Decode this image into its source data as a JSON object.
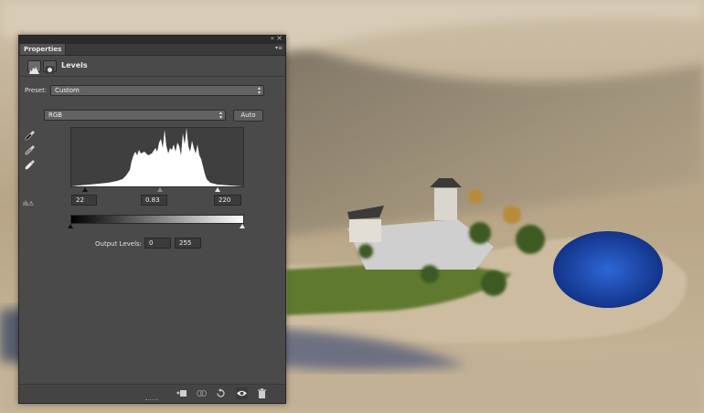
{
  "panel": {
    "tab_label": "Properties",
    "title": "Levels",
    "collapse_glyph": "«",
    "close_glyph": "×",
    "menu_glyph": "▾≡",
    "preset_label": "Preset:",
    "preset_value": "Custom",
    "channel_value": "RGB",
    "auto_label": "Auto",
    "input_black": "22",
    "input_gamma": "0.83",
    "input_white": "220",
    "output_label": "Output Levels:",
    "output_black": "0",
    "output_white": "255",
    "clip_icon_text": "ılı⚠"
  },
  "icons": {
    "header": [
      "levels-icon",
      "mask-icon"
    ],
    "eyedroppers": [
      "black-point-eyedropper-icon",
      "gray-point-eyedropper-icon",
      "white-point-eyedropper-icon"
    ],
    "bottom": [
      "clip-to-layer-icon",
      "view-previous-state-icon",
      "reset-icon",
      "visibility-eye-icon",
      "trash-icon"
    ]
  },
  "colors": {
    "panel_bg": "#4a4a4a",
    "field_bg": "#3b3b3b",
    "histogram_fill": "#ffffff"
  }
}
